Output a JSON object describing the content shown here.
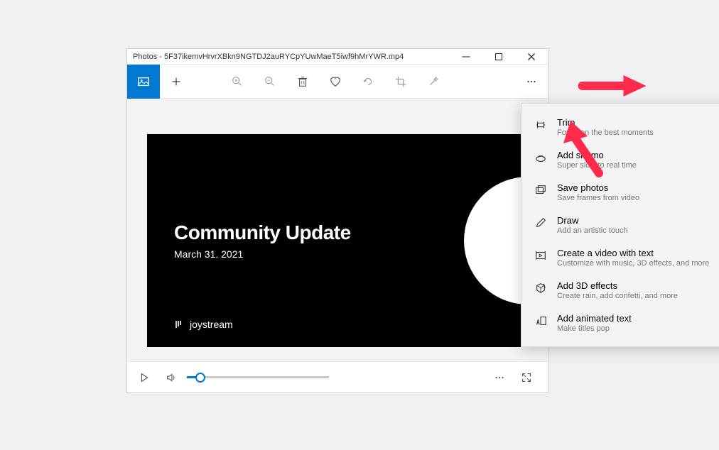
{
  "window": {
    "title": "Photos - 5F37ikemvHrvrXBkn9NGTDJ2auRYCpYUwMaeT5iwf9hMrYWR.mp4"
  },
  "video": {
    "title": "Community Update",
    "date": "March 31. 2021",
    "logo_text": "joystream"
  },
  "menu": {
    "items": [
      {
        "label": "Trim",
        "desc": "Focus on the best moments"
      },
      {
        "label": "Add slo-mo",
        "desc": "Super slow to real time"
      },
      {
        "label": "Save photos",
        "desc": "Save frames from video"
      },
      {
        "label": "Draw",
        "desc": "Add an artistic touch"
      },
      {
        "label": "Create a video with text",
        "desc": "Customize with music, 3D effects, and more"
      },
      {
        "label": "Add 3D effects",
        "desc": "Create rain, add confetti, and more"
      },
      {
        "label": "Add animated text",
        "desc": "Make titles pop"
      }
    ]
  },
  "annotation_color": "#ff2b4c"
}
